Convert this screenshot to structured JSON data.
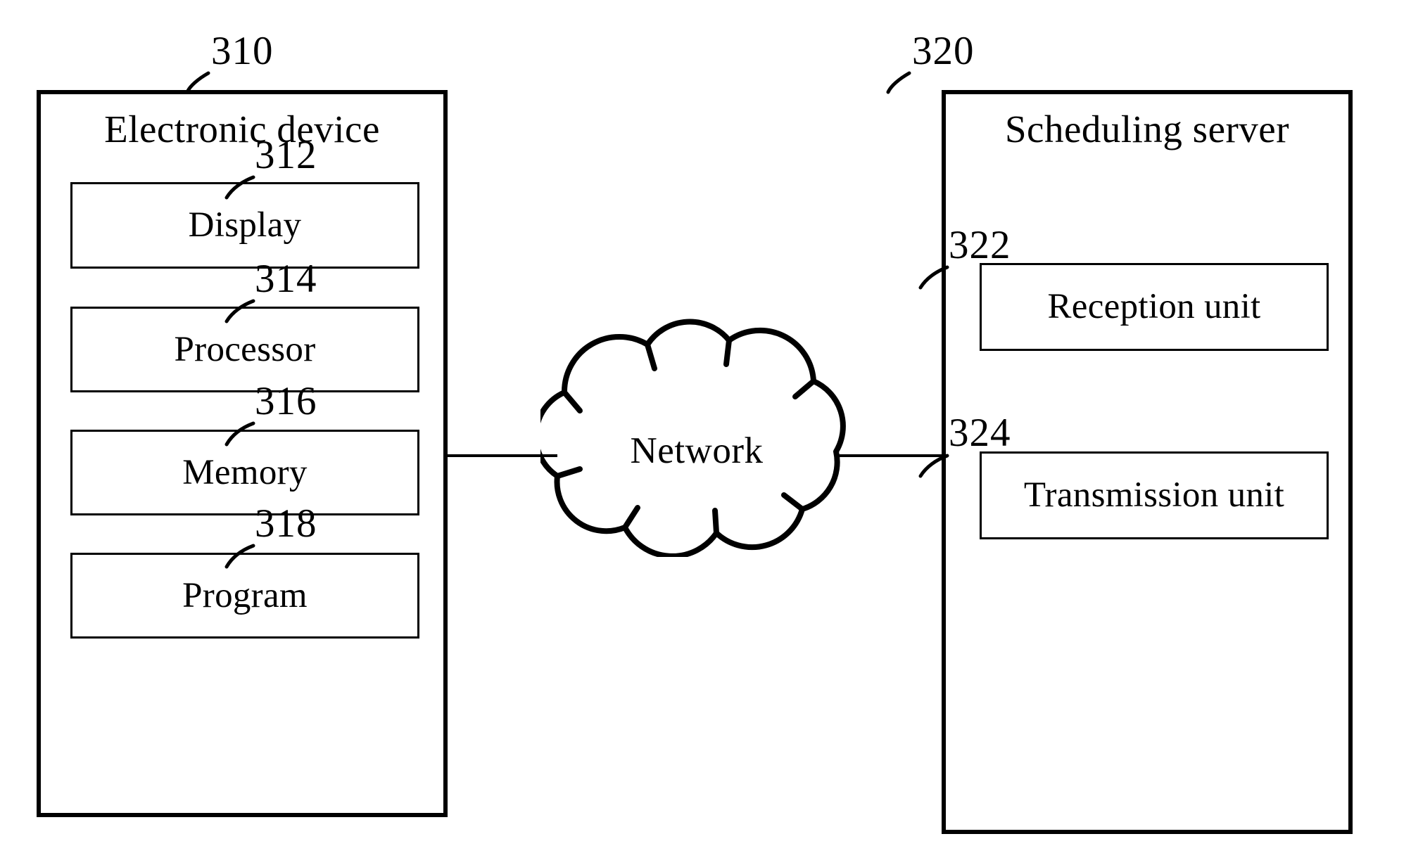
{
  "figure": {
    "type": "patent-block-diagram",
    "background_color": "#ffffff",
    "line_color": "#000000"
  },
  "electronic_device": {
    "title": "Electronic device",
    "ref": "310",
    "components": [
      {
        "label": "Display",
        "ref": "312"
      },
      {
        "label": "Processor",
        "ref": "314"
      },
      {
        "label": "Memory",
        "ref": "316"
      },
      {
        "label": "Program",
        "ref": "318"
      }
    ]
  },
  "network": {
    "label": "Network"
  },
  "scheduling_server": {
    "title": "Scheduling server",
    "ref": "320",
    "components": [
      {
        "label": "Reception unit",
        "ref": "322"
      },
      {
        "label": "Transmission unit",
        "ref": "324"
      }
    ]
  }
}
